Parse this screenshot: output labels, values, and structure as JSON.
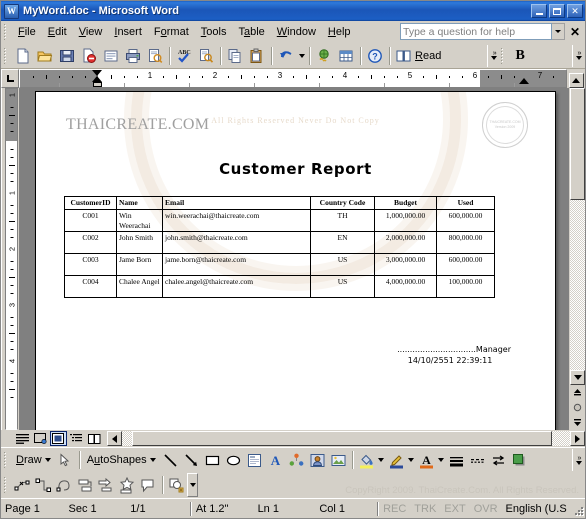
{
  "window": {
    "title": "MyWord.doc - Microsoft Word",
    "app_icon": "word-document-icon",
    "minimize_label": "Minimize",
    "maximize_label": "Maximize",
    "close_label": "Close"
  },
  "menu": {
    "items": [
      {
        "label": "File",
        "accel": "F"
      },
      {
        "label": "Edit",
        "accel": "E"
      },
      {
        "label": "View",
        "accel": "V"
      },
      {
        "label": "Insert",
        "accel": "I"
      },
      {
        "label": "Format",
        "accel": "o"
      },
      {
        "label": "Tools",
        "accel": "T"
      },
      {
        "label": "Table",
        "accel": "a"
      },
      {
        "label": "Window",
        "accel": "W"
      },
      {
        "label": "Help",
        "accel": "H"
      }
    ],
    "ask_placeholder": "Type a question for help",
    "ask_value": "",
    "close_label": "✕"
  },
  "toolbar": {
    "buttons": [
      {
        "name": "new-document-icon",
        "title": "New Blank Document"
      },
      {
        "name": "open-folder-icon",
        "title": "Open"
      },
      {
        "name": "save-disk-icon",
        "title": "Save"
      },
      {
        "name": "permission-icon",
        "title": "Permission"
      },
      {
        "name": "email-icon",
        "title": "E-mail"
      },
      {
        "name": "print-icon",
        "title": "Print"
      },
      {
        "name": "print-preview-icon",
        "title": "Print Preview"
      },
      {
        "name": "spelling-check-icon",
        "title": "Spelling and Grammar"
      },
      {
        "name": "research-icon",
        "title": "Research"
      },
      {
        "name": "copy-icon",
        "title": "Copy"
      },
      {
        "name": "paste-icon",
        "title": "Paste"
      },
      {
        "name": "undo-icon",
        "title": "Undo"
      },
      {
        "name": "insert-hyperlink-icon",
        "title": "Insert Hyperlink"
      },
      {
        "name": "insert-table-icon",
        "title": "Insert Table"
      },
      {
        "name": "help-icon",
        "title": "Microsoft Office Word Help"
      }
    ],
    "read_label": "Read",
    "read_accel": "R",
    "bold_label": "B",
    "overflow_label": "Toolbar Options"
  },
  "ruler": {
    "numbers": [
      "1",
      "2",
      "3",
      "4",
      "5",
      "6",
      "7"
    ],
    "tab_stop_label": "L",
    "unit": "inch",
    "vertical_numbers": [
      "1",
      "2",
      "3",
      "4"
    ]
  },
  "document": {
    "brand": "THAICREATE.COM",
    "seal": {
      "line1": "THAICREATE.COM",
      "line2": "Version 2009"
    },
    "watermark_text": "All Rights Reserved Never Do Not Copy",
    "title": "Customer Report",
    "table": {
      "headers": [
        "CustomerID",
        "Name",
        "Email",
        "Country Code",
        "Budget",
        "Used"
      ],
      "rows": [
        {
          "customer_id": "C001",
          "name": "Win Weerachai",
          "email": "win.weerachai@thaicreate.com",
          "country_code": "TH",
          "budget": "1,000,000.00",
          "used": "600,000.00"
        },
        {
          "customer_id": "C002",
          "name": "John Smith",
          "email": "john.smith@thaicreate.com",
          "country_code": "EN",
          "budget": "2,000,000.00",
          "used": "800,000.00"
        },
        {
          "customer_id": "C003",
          "name": "Jame Born",
          "email": "jame.born@thaicreate.com",
          "country_code": "US",
          "budget": "3,000,000.00",
          "used": "600,000.00"
        },
        {
          "customer_id": "C004",
          "name": "Chalee Angel",
          "email": "chalee.angel@thaicreate.com",
          "country_code": "US",
          "budget": "4,000,000.00",
          "used": "100,000.00"
        }
      ]
    },
    "signature_line": "...............................Manager",
    "signature_datetime": "14/10/2551 22:39:11"
  },
  "view_bar": {
    "buttons": [
      {
        "name": "normal-view-icon",
        "label": "Normal View",
        "active": false
      },
      {
        "name": "web-layout-view-icon",
        "label": "Web Layout View",
        "active": false
      },
      {
        "name": "print-layout-view-icon",
        "label": "Print Layout View",
        "active": true
      },
      {
        "name": "outline-view-icon",
        "label": "Outline View",
        "active": false
      },
      {
        "name": "reading-layout-view-icon",
        "label": "Reading Layout View",
        "active": false
      }
    ]
  },
  "drawing_toolbar": {
    "draw_label": "Draw",
    "draw_accel": "D",
    "autoshapes_label": "AutoShapes",
    "autoshapes_accel": "u",
    "buttons": [
      {
        "name": "select-objects-icon",
        "title": "Select Objects"
      },
      {
        "name": "line-icon",
        "title": "Line"
      },
      {
        "name": "arrow-icon",
        "title": "Arrow"
      },
      {
        "name": "rectangle-icon",
        "title": "Rectangle"
      },
      {
        "name": "oval-icon",
        "title": "Oval"
      },
      {
        "name": "text-box-icon",
        "title": "Text Box"
      },
      {
        "name": "wordart-icon",
        "title": "Insert WordArt"
      },
      {
        "name": "diagram-icon",
        "title": "Insert Diagram or Organization Chart"
      },
      {
        "name": "clip-art-icon",
        "title": "Insert Clip Art"
      },
      {
        "name": "insert-picture-icon",
        "title": "Insert Picture"
      },
      {
        "name": "fill-color-icon",
        "title": "Fill Color"
      },
      {
        "name": "line-color-icon",
        "title": "Line Color"
      },
      {
        "name": "font-color-icon",
        "title": "Font Color"
      },
      {
        "name": "line-style-icon",
        "title": "Line Style"
      },
      {
        "name": "dash-style-icon",
        "title": "Dash Style"
      },
      {
        "name": "arrow-style-icon",
        "title": "Arrow Style"
      },
      {
        "name": "shadow-style-icon",
        "title": "Shadow Style"
      }
    ],
    "row2_buttons": [
      {
        "name": "shape-node-edit-icon",
        "title": "Edit Points"
      },
      {
        "name": "connector-icon",
        "title": "Connector"
      },
      {
        "name": "freeform-icon",
        "title": "Freeform"
      },
      {
        "name": "flowchart-icon",
        "title": "Flowchart"
      },
      {
        "name": "block-arrows-icon",
        "title": "Block Arrows"
      },
      {
        "name": "stars-banners-icon",
        "title": "Stars and Banners"
      },
      {
        "name": "callouts-icon",
        "title": "Callouts"
      },
      {
        "name": "more-autoshapes-icon",
        "title": "More AutoShapes"
      }
    ]
  },
  "copyright": "CopyRight 2009. ThaiCreate.Com. All Rights Reserved.",
  "status_bar": {
    "page": "Page  1",
    "section": "Sec  1",
    "page_of": "1/1",
    "at": "At  1.2\"",
    "line": "Ln  1",
    "column": "Col  1",
    "rec": "REC",
    "trk": "TRK",
    "ext": "EXT",
    "ovr": "OVR",
    "language": "English (U.S"
  },
  "colors": {
    "title_bar": "#1c5fc4",
    "chrome": "#d4d0c8",
    "page_background": "#808080",
    "accent_highlight": "#316ac5"
  }
}
